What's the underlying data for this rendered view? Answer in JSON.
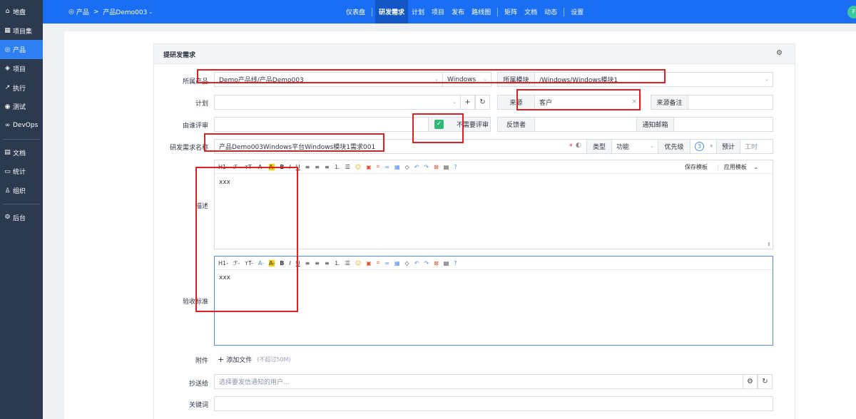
{
  "sidebar": {
    "items": [
      {
        "icon": "home-icon",
        "glyph": "⌂",
        "label": "地盘"
      },
      {
        "icon": "grid-icon",
        "glyph": "▦",
        "label": "项目集"
      },
      {
        "icon": "location-icon",
        "glyph": "◎",
        "label": "产品"
      },
      {
        "icon": "cube-icon",
        "glyph": "◈",
        "label": "项目"
      },
      {
        "icon": "run-icon",
        "glyph": "↗",
        "label": "执行"
      },
      {
        "icon": "test-icon",
        "glyph": "◉",
        "label": "测试"
      },
      {
        "icon": "infinity-icon",
        "glyph": "∞",
        "label": "DevOps"
      },
      {
        "icon": "doc-icon",
        "glyph": "▤",
        "label": "文档"
      },
      {
        "icon": "chart-icon",
        "glyph": "▭",
        "label": "统计"
      },
      {
        "icon": "org-icon",
        "glyph": "♙",
        "label": "组织"
      },
      {
        "icon": "settings-icon",
        "glyph": "⚙",
        "label": "后台"
      }
    ],
    "active_index": 2
  },
  "topbar": {
    "crumb_root": "产品",
    "crumb_sep": ">",
    "crumb_current": "产品Demo003",
    "nav": [
      "仪表盘",
      "研发需求",
      "计划",
      "项目",
      "发布",
      "路线图",
      "矩阵",
      "文档",
      "动态",
      "设置"
    ],
    "active_nav": "研发需求",
    "avatar": "F"
  },
  "form": {
    "title": "提研发需求",
    "product_label": "所属产品",
    "product_value": "Demo产品线/产品Demo003",
    "branch_value": "Windows",
    "module_addon": "所属模块",
    "module_value": "/Windows/Windows模块1",
    "plan_label": "计划",
    "source_addon": "来源",
    "source_value": "客户",
    "source_note_addon": "来源备注",
    "reviewer_label": "由谁评审",
    "no_review_label": "不需要评审",
    "feedback_addon": "反馈者",
    "notify_addon": "通知邮箱",
    "name_label": "研发需求名称",
    "name_value": "产品Demo003Windows平台Windows模块1需求001",
    "required_mark": "*",
    "type_addon": "类型",
    "type_value": "功能",
    "priority_addon": "优先级",
    "priority_value": "3",
    "estimate_addon": "预计",
    "estimate_placeholder": "工时",
    "desc_label": "描述",
    "desc_text": "xxx",
    "accept_label": "验收标准",
    "accept_text": "xxx",
    "save_template": "保存模板",
    "apply_template": "应用模板",
    "attach_label": "附件",
    "add_file": "添加文件",
    "file_limit": "(不超过50M)",
    "cc_label": "抄送给",
    "cc_placeholder": "选择要发信通知的用户...",
    "keywords_label": "关键词"
  },
  "toolbar": [
    "H1-",
    "ℱ-",
    "ᴛT-",
    "A-",
    "A-",
    "B",
    "I",
    "U",
    "≡",
    "≡",
    "≡",
    "⒈",
    "☰",
    "☺",
    "▣",
    "⌗",
    "∞",
    "▦",
    "◇",
    "↶",
    "↷",
    "⊠",
    "▤",
    "?"
  ]
}
